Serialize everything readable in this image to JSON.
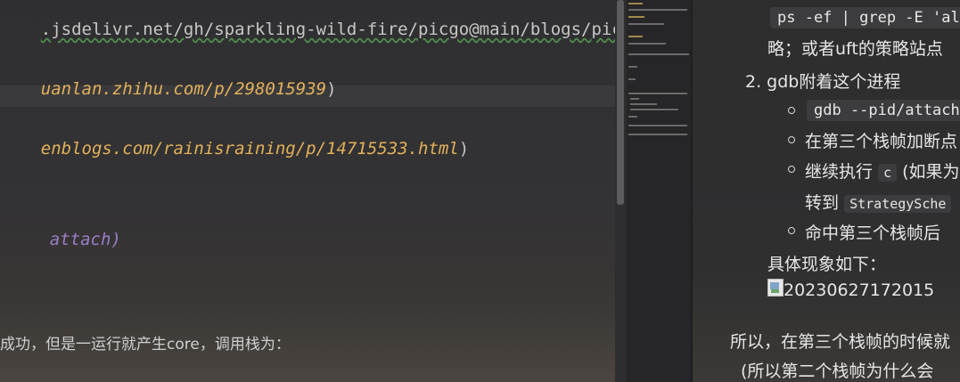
{
  "editor": {
    "line1_url": ".jsdelivr.net/gh/sparkling-wild-fire/picgo@main/blogs/pictu",
    "line2_url": "uanlan.zhihu.com/p/298015939",
    "line2_close": ")",
    "line3_url": "enblogs.com/rainisraining/p/14715533.html",
    "line3_close": ")",
    "line4_text": "attach)",
    "line5_text": "成功，但是一运行就产生core，调用栈为："
  },
  "preview": {
    "code_cmd": "ps -ef | grep -E 'al",
    "text_strategy": "略；或者uft的策略站点",
    "item2_label": "2. gdb附着这个进程",
    "code_gdb": "gdb --pid/attach",
    "bullet2_text": "在第三个栈帧加断点",
    "bullet3_pre": "继续执行",
    "bullet3_code": "c",
    "bullet3_post": "(如果为",
    "bullet3_line2_pre": "转到",
    "bullet3_line2_code": "StrategySche",
    "bullet4_text": "命中第三个栈帧后",
    "phenomenon_text": "具体现象如下：",
    "image_alt": "20230627172015",
    "summary_line1": "所以，在第三个栈帧的时候就",
    "summary_line2": "(所以第二个栈帧为什么会"
  }
}
